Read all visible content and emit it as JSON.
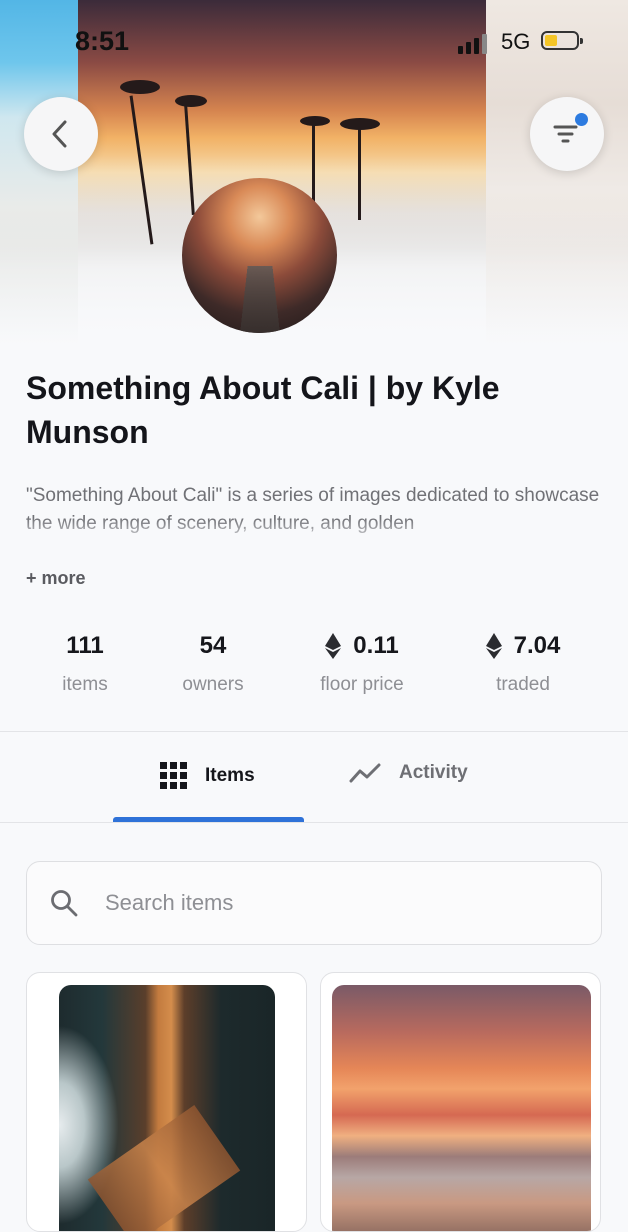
{
  "status_bar": {
    "time": "8:51",
    "network": "5G"
  },
  "header": {
    "back_icon": "chevron-left-icon",
    "filter_icon": "filter-icon",
    "filter_indicator_color": "#2d7be0"
  },
  "collection": {
    "title": "Something About Cali | by Kyle Munson",
    "description": "\"Something About Cali\" is a series of images dedicated to showcase the wide range of scenery, culture, and golden",
    "more_label": "+ more"
  },
  "stats": [
    {
      "value": "111",
      "label": "items"
    },
    {
      "value": "54",
      "label": "owners"
    },
    {
      "value": "0.11",
      "label": "floor price",
      "icon": "ethereum-icon"
    },
    {
      "value": "7.04",
      "label": "traded",
      "icon": "ethereum-icon"
    }
  ],
  "tabs": [
    {
      "label": "Items",
      "icon": "grid-icon",
      "active": true
    },
    {
      "label": "Activity",
      "icon": "activity-chart-icon",
      "active": false
    }
  ],
  "accent_color": "#2f72d8",
  "search": {
    "placeholder": "Search items",
    "value": ""
  }
}
